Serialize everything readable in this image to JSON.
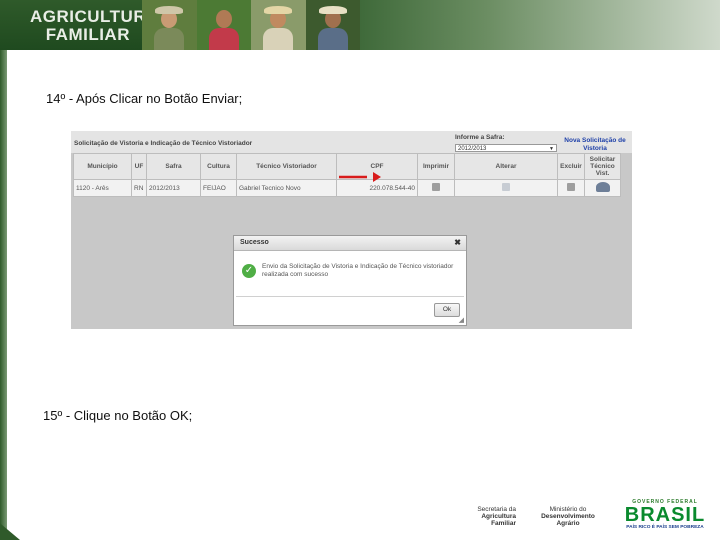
{
  "header": {
    "logo_line1": "AGRICULTURA",
    "logo_line2": "FAMILIAR"
  },
  "steps": {
    "step14": "14º - Após Clicar no Botão Enviar;",
    "step15": "15º - Clique no Botão OK;"
  },
  "screenshot": {
    "title": "Solicitação de Vistoria e Indicação de Técnico Vistoriador",
    "safra_label": "Informe a Safra:",
    "safra_value": "2012/2013",
    "new_request_link": "Nova Solicitação de Vistoria",
    "columns": [
      "Município",
      "UF",
      "Safra",
      "Cultura",
      "Técnico Vistoriador",
      "CPF",
      "Imprimir",
      "Alterar",
      "Excluir",
      "Solicitar Técnico Vist."
    ],
    "row": {
      "municipio": "1120 - Arês",
      "uf": "RN",
      "safra": "2012/2013",
      "cultura": "FEIJAO",
      "tecnico": "Gabriel Tecnico Novo",
      "cpf": "220.078.544-40"
    },
    "icons": {
      "print": "printer-icon",
      "edit": "edit-icon",
      "delete": "delete-icon",
      "request": "request-technician-icon"
    }
  },
  "dialog": {
    "title": "Sucesso",
    "close": "✖",
    "message": "Envio da Solicitação de Vistoria e Indicação de Técnico vistoriador realizada com sucesso",
    "ok_label": "Ok",
    "accent": "#4fae45"
  },
  "footer": {
    "sec_line1": "Secretaria da",
    "sec_line2": "Agricultura Familiar",
    "min_line1": "Ministério do",
    "min_line2": "Desenvolvimento Agrário",
    "gov_top": "GOVERNO FEDERAL",
    "brasil": "BRASIL",
    "slogan": "PAÍS RICO É PAÍS SEM POBREZA"
  },
  "colors": {
    "brand_green": "#2f5a2a",
    "arrow_red": "#d81b1b",
    "link_blue": "#1d3fa8"
  }
}
